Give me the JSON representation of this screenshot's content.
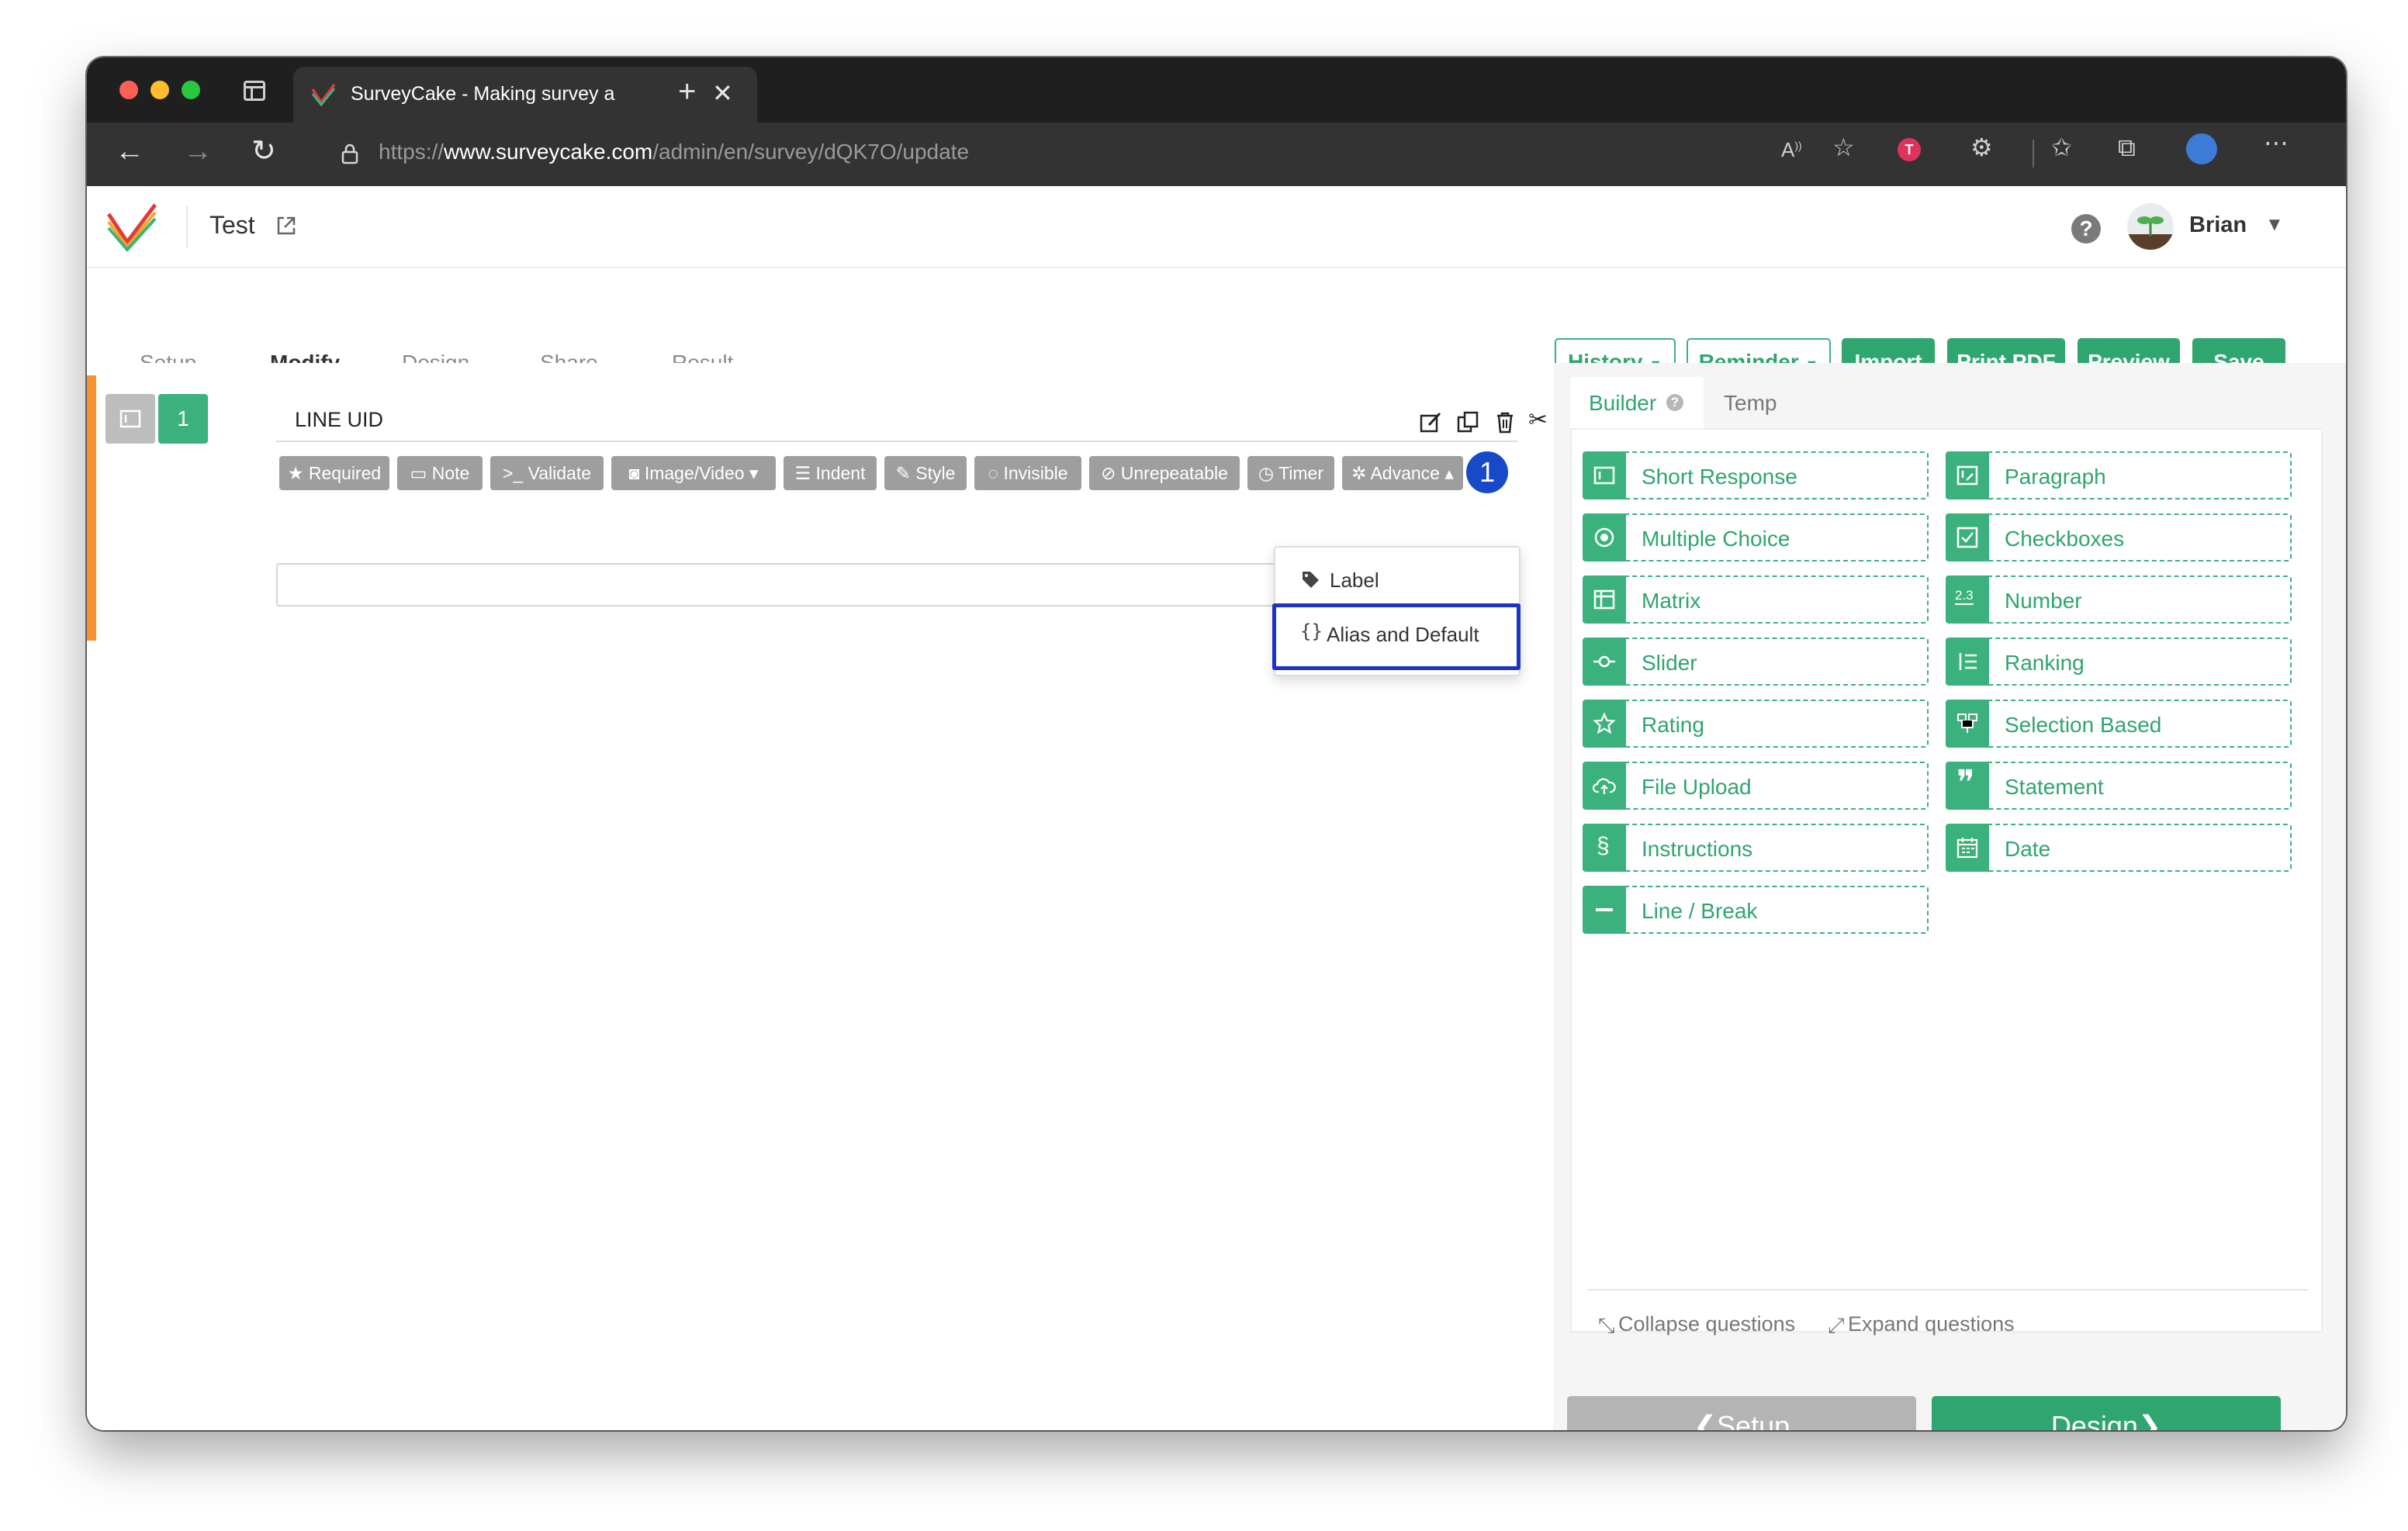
{
  "browser": {
    "tab_title": "SurveyCake - Making survey a",
    "url_protocol": "https://",
    "url_host": "www.surveycake.com",
    "url_path": "/admin/en/survey/dQK7O/update"
  },
  "header": {
    "project_title": "Test",
    "user_name": "Brian",
    "help_glyph": "?"
  },
  "steps": [
    {
      "label": "Setup",
      "active": false
    },
    {
      "label": "Modify",
      "active": true
    },
    {
      "label": "Design",
      "active": false
    },
    {
      "label": "Share",
      "active": false
    },
    {
      "label": "Result",
      "active": false
    }
  ],
  "step_arrow": "→",
  "actions": {
    "history": "History",
    "reminder": "Reminder",
    "import": "Import",
    "print_pdf": "Print PDF",
    "preview": "Preview",
    "save": "Save"
  },
  "question": {
    "number": "1",
    "title": "LINE UID",
    "options": [
      "Required",
      "Note",
      "Validate",
      "Image/Video",
      "Indent",
      "Style",
      "Invisible",
      "Unrepeatable",
      "Timer",
      "Advance"
    ]
  },
  "annotation_badge": "1",
  "advance_menu": {
    "items": [
      "Label",
      "Alias and Default"
    ],
    "highlighted": "Alias and Default"
  },
  "builder": {
    "tabs": [
      "Builder",
      "Temp"
    ],
    "active_tab": "Builder",
    "question_types_left": [
      "Short Response",
      "Multiple Choice",
      "Matrix",
      "Slider",
      "Rating",
      "File Upload",
      "Instructions",
      "Line / Break"
    ],
    "question_types_right": [
      "Paragraph",
      "Checkboxes",
      "Number",
      "Ranking",
      "Selection Based",
      "Statement",
      "Date"
    ],
    "number_icon_text": "2.3",
    "collapse": "Collapse questions",
    "expand": "Expand questions"
  },
  "footer_nav": {
    "back": "Setup",
    "next": "Design"
  },
  "colors": {
    "brand_green": "#2fa56f",
    "accent_orange": "#f5922f",
    "highlight_blue": "#1c33c4",
    "badge_blue": "#1749c9",
    "chip_gray": "#9e9e9e"
  }
}
